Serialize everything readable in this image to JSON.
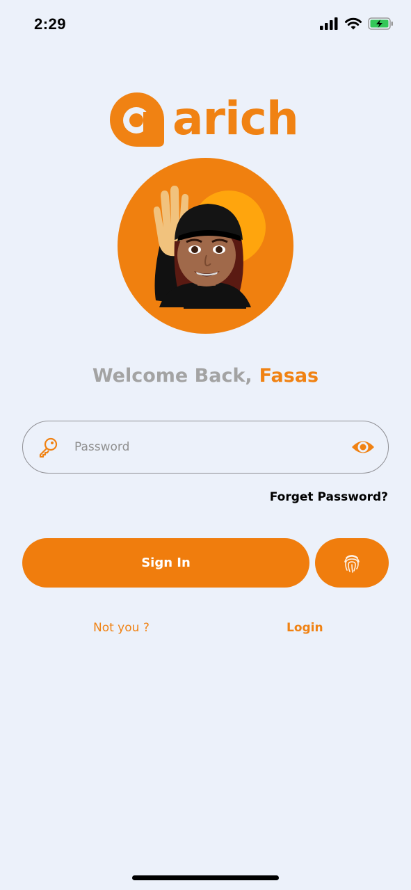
{
  "status_bar": {
    "time": "2:29",
    "icons": [
      "cellular-signal-icon",
      "wifi-icon",
      "battery-charging-icon"
    ]
  },
  "logo": {
    "text": "arich",
    "color": "#F08213"
  },
  "avatar": {
    "description_icon": "memoji-waving-avatar",
    "bg_color": "#F0800F"
  },
  "welcome": {
    "prefix": "Welcome Back,",
    "name": "Fasas"
  },
  "password_field": {
    "placeholder": "Password",
    "value": "",
    "leading_icon": "key-icon",
    "trailing_icon": "eye-icon"
  },
  "forget_password": {
    "label": "Forget Password?"
  },
  "actions": {
    "sign_in_label": "Sign In",
    "biometric_icon": "fingerprint-icon"
  },
  "footer_links": {
    "not_you": "Not you ?",
    "login": "Login"
  },
  "colors": {
    "accent": "#F07D0D",
    "background": "#ECF1FA",
    "muted_text": "#A3A3A3"
  }
}
